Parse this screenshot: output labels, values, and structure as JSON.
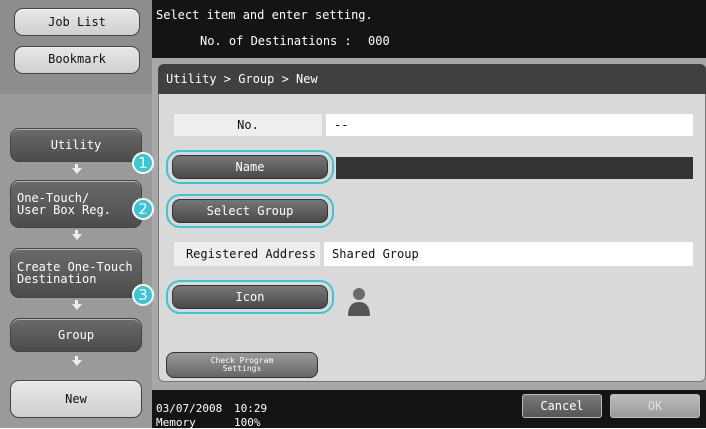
{
  "sidebar": {
    "job_list": "Job List",
    "bookmark": "Bookmark",
    "utility": "Utility",
    "one_touch": "One-Touch/\nUser Box Reg.",
    "create_dest": "Create One-Touch\nDestination",
    "group": "Group",
    "new": "New"
  },
  "header": {
    "instruction": "Select item and enter setting.",
    "destinations_label": "No. of Destinations :",
    "destinations_value": "000"
  },
  "breadcrumb": "Utility > Group > New",
  "form": {
    "no_label": "No.",
    "no_value": "--",
    "name_button": "Name",
    "name_value": "",
    "select_group_button": "Select Group",
    "registered_label": "Registered Address",
    "registered_value": "Shared Group",
    "icon_button": "Icon",
    "icon_name": "person-icon",
    "check_program": "Check Program\nSettings"
  },
  "callouts": [
    "1",
    "2",
    "3"
  ],
  "footer": {
    "date": "03/07/2008",
    "time": "10:29",
    "memory_label": "Memory",
    "memory_value": "100%",
    "cancel": "Cancel",
    "ok": "OK"
  },
  "colors": {
    "highlight": "#39c6d6"
  }
}
